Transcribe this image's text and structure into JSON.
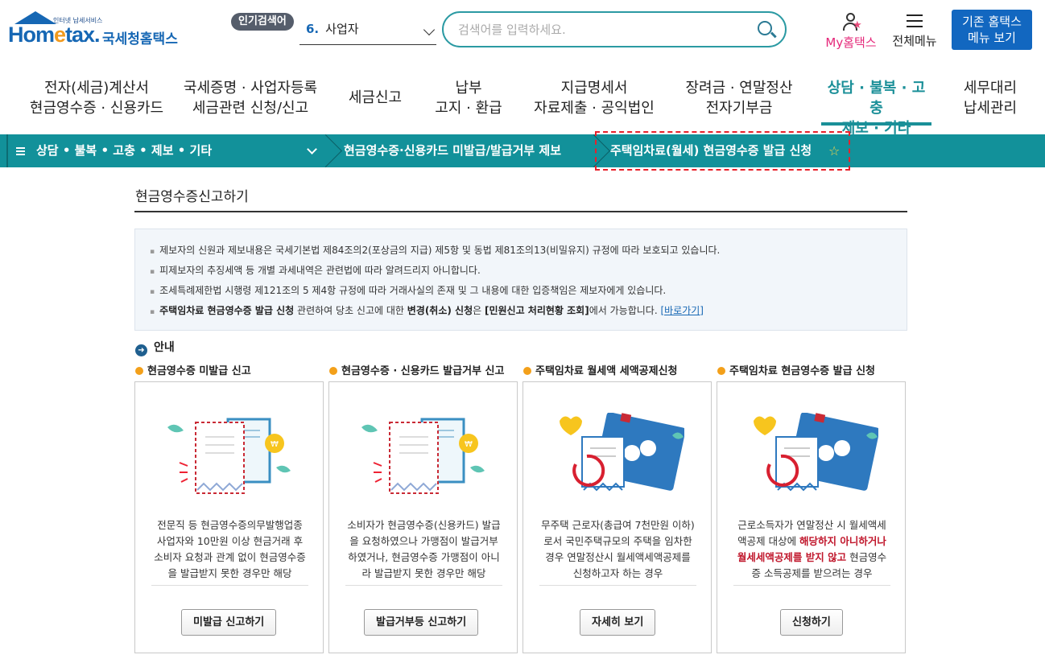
{
  "header": {
    "logo_tagline": "인터넷 납세서비스",
    "logo_brand_a": "Hom",
    "logo_brand_e": "e",
    "logo_brand_b": "tax.",
    "logo_kname": "국세청홈택스",
    "popular_badge": "인기검색어",
    "popular_rank": "6.",
    "popular_term": "사업자",
    "search_placeholder": "검색어를 입력하세요.",
    "my_hometax": "My홈택스",
    "all_menu": "전체메뉴",
    "old_menu_line1": "기존 홈택스",
    "old_menu_line2": "메뉴 보기"
  },
  "nav": [
    {
      "l1": "전자(세금)계산서",
      "l2": "현금영수증 · 신용카드"
    },
    {
      "l1": "국세증명 · 사업자등록",
      "l2": "세금관련 신청/신고"
    },
    {
      "l1": "세금신고",
      "l2": ""
    },
    {
      "l1": "납부",
      "l2": "고지 · 환급"
    },
    {
      "l1": "지급명세서",
      "l2": "자료제출 · 공익법인"
    },
    {
      "l1": "장려금 · 연말정산",
      "l2": "전자기부금"
    },
    {
      "l1": "상담 · 불복 · 고충",
      "l2": "제보 · 기타"
    },
    {
      "l1": "세무대리",
      "l2": "납세관리"
    }
  ],
  "breadcrumb": {
    "level1": "상담 • 불복 • 고충 • 제보 • 기타",
    "level2": "현금영수증·신용카드 미발급/발급거부 제보",
    "level3": "주택임차료(월세) 현금영수증 발급 신청",
    "favorite_icon": "☆"
  },
  "page": {
    "title": "현금영수증신고하기",
    "notice": {
      "line1": "제보자의 신원과 제보내용은 국세기본법 제84조의2(포상금의 지급) 제5항 및 동법 제81조의13(비밀유지) 규정에 따라 보호되고 있습니다.",
      "line2": "피제보자의 추징세액 등 개별 과세내역은 관련법에 따라 알려드리지 아니합니다.",
      "line3": "조세특례제한법 시행령 제121조의 5 제4항 규정에 따라 거래사실의 존재 및 그 내용에 대한 입증책임은 제보자에게 있습니다.",
      "line4_bold1": "주택임차료 현금영수증 발급 신청",
      "line4_mid1": " 관련하여 당초 신고에 대한 ",
      "line4_bold2": "변경(취소) 신청",
      "line4_mid2": "은 ",
      "line4_bold3": "[민원신고 처리현황 조회]",
      "line4_tail": "에서 가능합니다. ",
      "line4_link": "[바로가기]"
    },
    "guide_label": "안내",
    "guide_icon": "➜"
  },
  "cards": [
    {
      "title": "현금영수증 미발급 신고",
      "desc_a": "전문직 등 현금영수증의무발행업종 사업자와 10만원 이상 현금거래 후 소비자 요청과 관계 없이 현금영수증을 발급받지 못한 경우만 해당",
      "desc_hl": "",
      "desc_b": "",
      "button": "미발급 신고하기"
    },
    {
      "title": "현금영수증 · 신용카드 발급거부 신고",
      "desc_a": "소비자가 현금영수증(신용카드) 발급을 요청하였으나 가맹점이 발급거부 하였거나, 현금영수증 가맹점이 아니라 발급받지 못한 경우만 해당",
      "desc_hl": "",
      "desc_b": "",
      "button": "발급거부등 신고하기"
    },
    {
      "title": "주택임차료 월세액 세액공제신청",
      "desc_a": "무주택 근로자(총급여 7천만원 이하)로서 국민주택규모의 주택을 임차한 경우 연말정산시 월세액세액공제를 신청하고자 하는 경우",
      "desc_hl": "",
      "desc_b": "",
      "button": "자세히 보기"
    },
    {
      "title": "주택임차료 현금영수증 발급 신청",
      "desc_a": "근로소득자가 연말정산 시 월세액세액공제 대상에 ",
      "desc_hl": "해당하지 아니하거나 월세세액공제를 받지 않고",
      "desc_b": " 현금영수증 소득공제를 받으려는 경우",
      "button": "신청하기"
    }
  ],
  "colors": {
    "brand_blue": "#1667b4",
    "teal": "#12919a",
    "accent_pink": "#e5287a",
    "highlight_red": "#c0162b",
    "orange_bullet": "#f3a01a"
  }
}
